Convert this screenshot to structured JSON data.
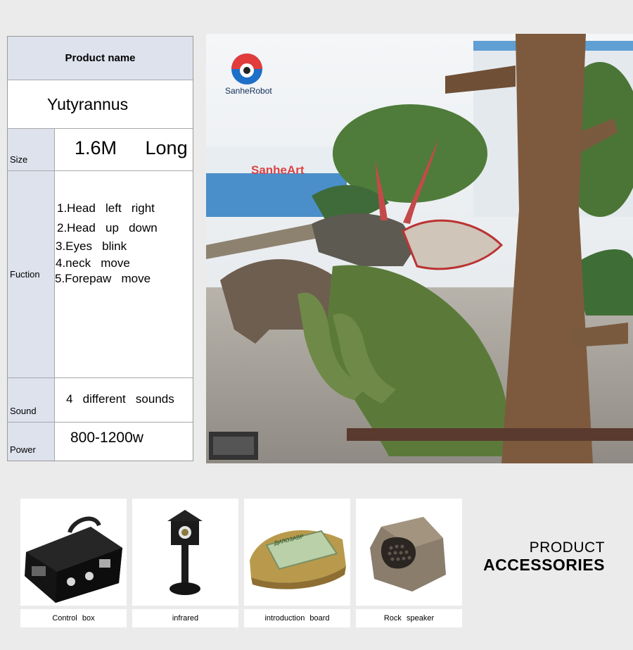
{
  "spec": {
    "header": "Product  name",
    "product_name": "Yutyrannus",
    "size_label": "Size",
    "size_value": "1.6M   Long",
    "function_label": "Fuction",
    "functions": [
      "1.Head   left   right",
      "2.Head   up   down",
      "3.Eyes   blink",
      "4.neck   move",
      "5.Forepaw   move"
    ],
    "sound_label": "Sound",
    "sound_value": "4   different   sounds",
    "power_label": "Power",
    "power_value": "800-1200w"
  },
  "photo": {
    "logo_text": "SanheRobot",
    "sign_text": "SanheArt"
  },
  "accessories": {
    "title_line1": "PRODUCT",
    "title_line2": "ACCESSORIES",
    "items": [
      {
        "label": "Control   box",
        "icon": "control-box-icon"
      },
      {
        "label": "infrared",
        "icon": "infrared-sensor-icon"
      },
      {
        "label": "introduction   board",
        "icon": "introduction-board-icon"
      },
      {
        "label": "Rock   speaker",
        "icon": "rock-speaker-icon"
      }
    ],
    "board_text": "ДИЛОЗАВР"
  }
}
